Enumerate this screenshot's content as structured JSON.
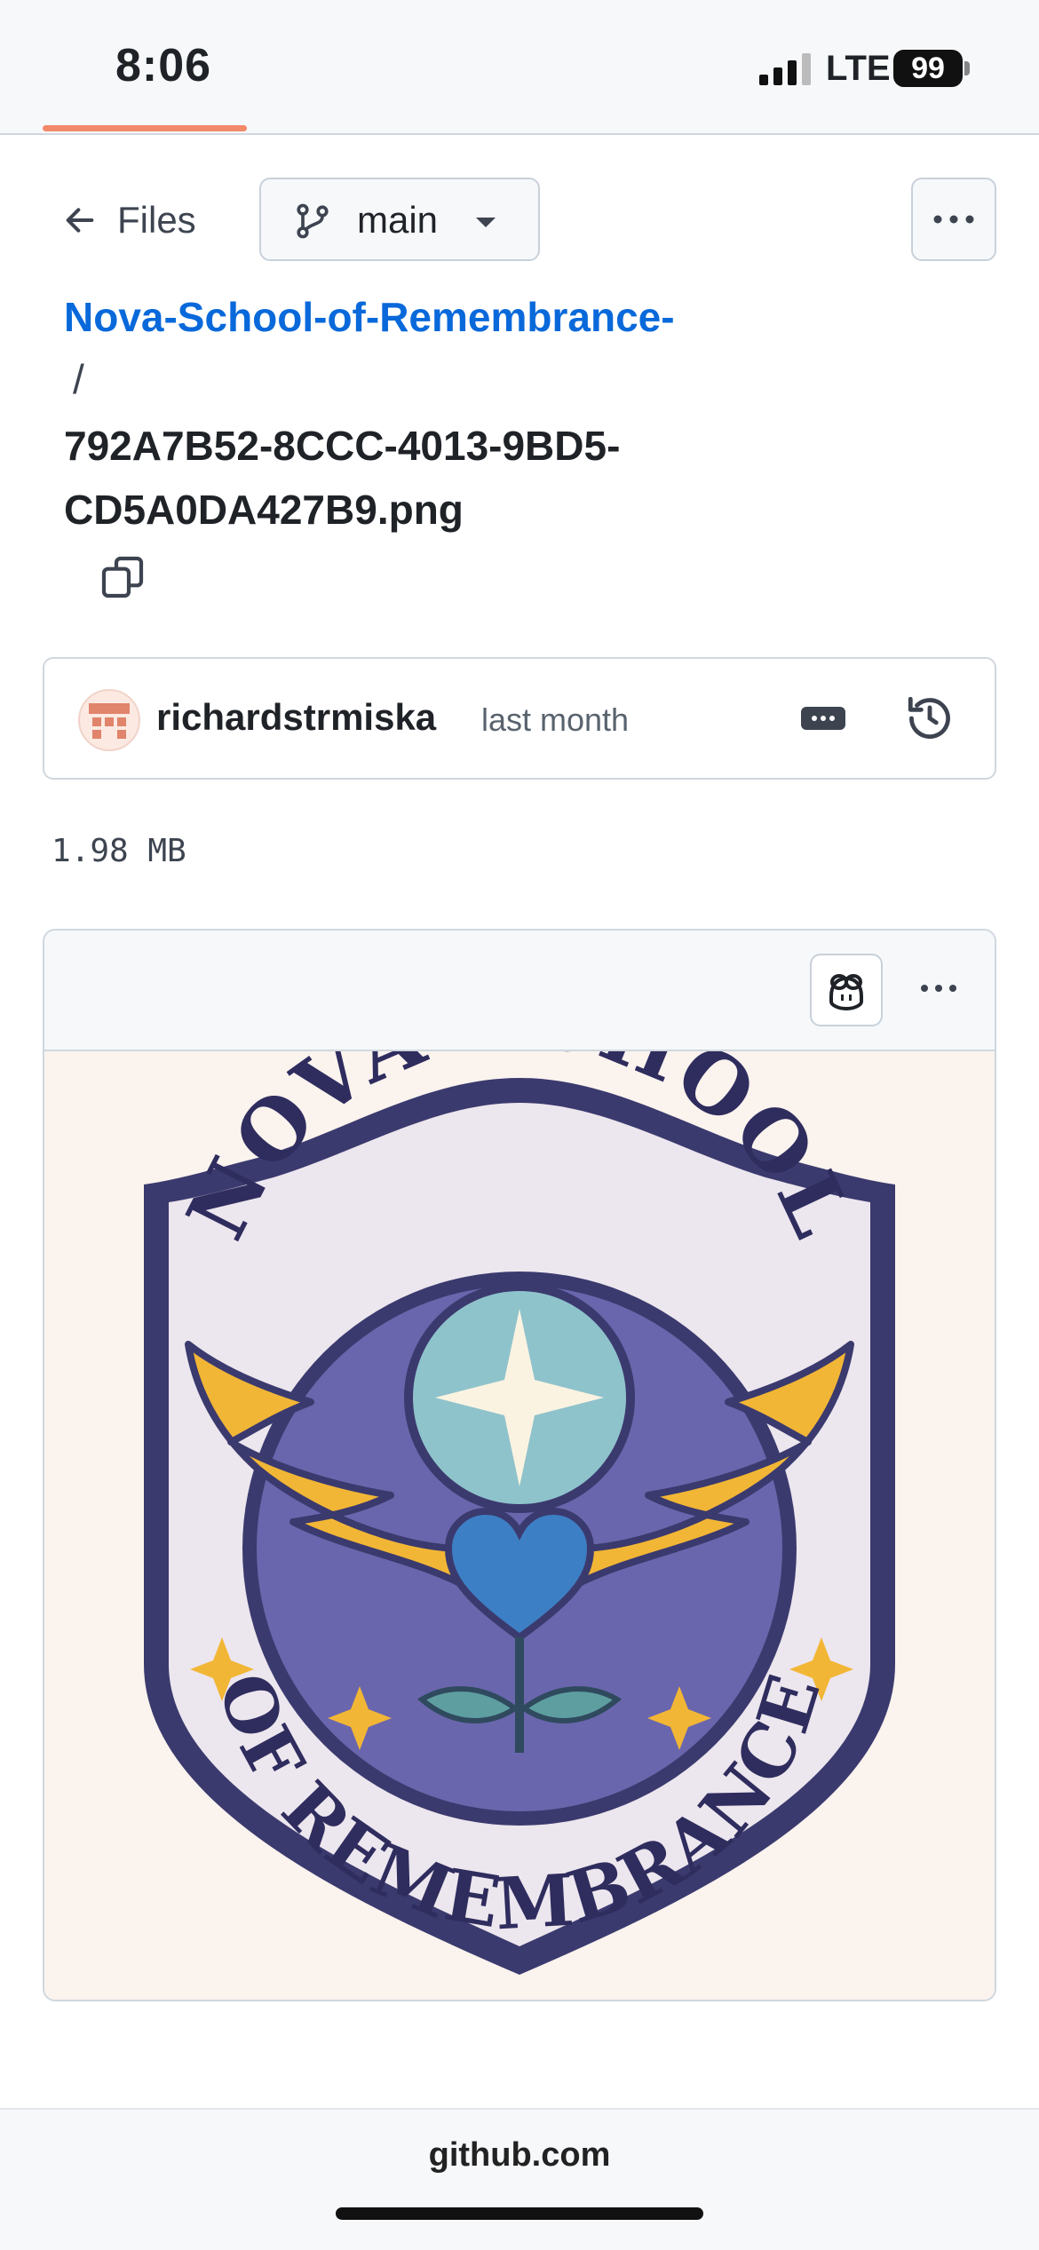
{
  "status": {
    "time": "8:06",
    "network": "LTE",
    "battery": "99"
  },
  "header": {
    "back_label": "Files",
    "branch": "main"
  },
  "path": {
    "repo": "Nova-School-of-Remembrance-",
    "separator": "/",
    "file": "792A7B52-8CCC-4013-9BD5-CD5A0DA427B9.png"
  },
  "commit": {
    "author": "richardstrmiska",
    "when": "last month"
  },
  "file_size": "1.98 MB",
  "image": {
    "logo_top_text": "NOVA SCHOOL",
    "logo_bottom_text": "OF REMEMBRANCE"
  },
  "footer": {
    "domain": "github.com"
  },
  "colors": {
    "link": "#0969da",
    "accent": "#f28a6a",
    "crest_purple": "#3b3a6e",
    "wing_gold": "#f2b636"
  }
}
